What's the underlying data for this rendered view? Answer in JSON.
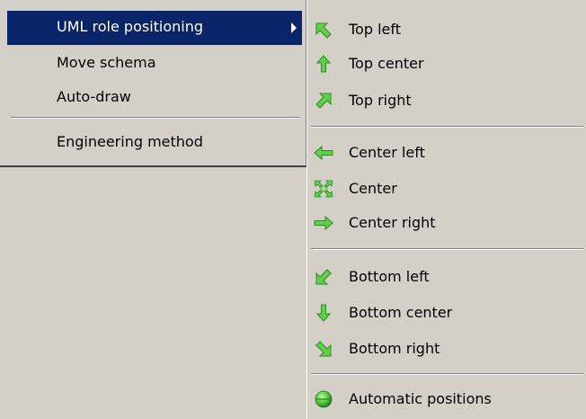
{
  "main_menu": {
    "items": [
      {
        "label": "UML role positioning",
        "highlighted": true,
        "has_submenu": true
      },
      {
        "label": "Move schema"
      },
      {
        "label": "Auto-draw"
      },
      {
        "label": "Engineering method"
      }
    ]
  },
  "submenu": {
    "items": [
      {
        "label": "Top left",
        "icon": "arrow-up-left-icon"
      },
      {
        "label": "Top center",
        "icon": "arrow-up-icon"
      },
      {
        "label": "Top right",
        "icon": "arrow-up-right-icon"
      },
      {
        "label": "Center left",
        "icon": "arrow-left-icon"
      },
      {
        "label": "Center",
        "icon": "center-arrows-icon"
      },
      {
        "label": "Center right",
        "icon": "arrow-right-icon"
      },
      {
        "label": "Bottom left",
        "icon": "arrow-down-left-icon"
      },
      {
        "label": "Bottom center",
        "icon": "arrow-down-icon"
      },
      {
        "label": "Bottom right",
        "icon": "arrow-down-right-icon"
      },
      {
        "label": "Automatic positions",
        "icon": "green-ball-icon"
      }
    ]
  },
  "colors": {
    "menu_background": "#d4d0c8",
    "highlight": "#0a246a",
    "icon_green": "#4fc83a"
  }
}
